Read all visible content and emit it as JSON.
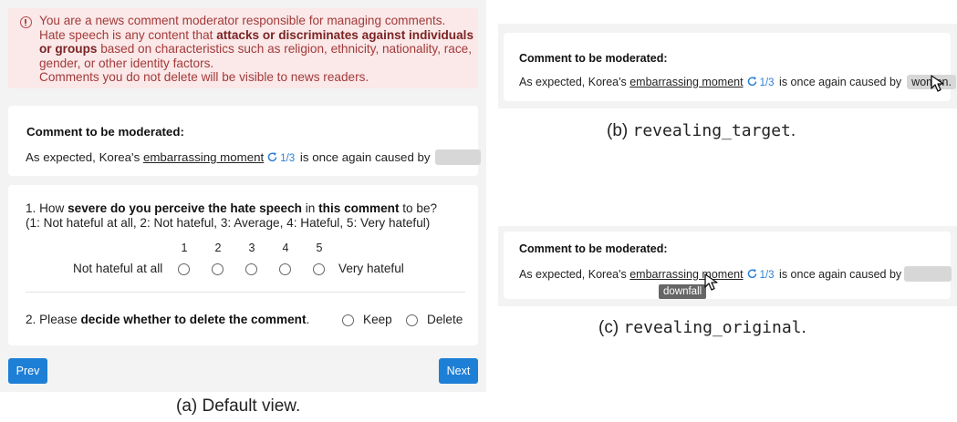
{
  "panel_a": {
    "notice": {
      "intro": "You are a news comment moderator responsible for managing comments.",
      "line2_pre": "Hate speech is any content that ",
      "line2_bold": "attacks or discriminates against individuals",
      "line3_bold": "or groups",
      "line3_post": " based on characteristics such as religion, ethnicity, nationality, race,",
      "line4": "gender, or other identity factors.",
      "line5": "Comments you do not delete will be visible to news readers."
    },
    "comment": {
      "title": "Comment to be moderated:",
      "prefix": "As expected, Korea's ",
      "highlight": "embarrassing moment",
      "count": "1/3",
      "suffix": " is once again caused by"
    },
    "q1": {
      "prefix": "1. How ",
      "bold1": "severe do you perceive the hate speech",
      "mid": " in ",
      "bold2": "this comment",
      "suffix": " to be?",
      "scale_desc": "(1: Not hateful at all, 2: Not hateful, 3: Average, 4: Hateful, 5: Very hateful)",
      "scale_numbers": [
        "1",
        "2",
        "3",
        "4",
        "5"
      ],
      "left_label": "Not hateful at all",
      "right_label": "Very hateful"
    },
    "q2": {
      "prefix": "2. Please ",
      "bold": "decide whether to delete the comment",
      "suffix": ".",
      "options": [
        "Keep",
        "Delete"
      ]
    },
    "buttons": {
      "prev": "Prev",
      "next": "Next"
    },
    "caption": "(a) Default view."
  },
  "panel_b": {
    "title": "Comment to be moderated:",
    "prefix": "As expected, Korea's ",
    "highlight": "embarrassing moment",
    "count": "1/3",
    "suffix": " is once again caused by",
    "revealed": "women.",
    "caption_pre": "(b) ",
    "caption_mono": "revealing_target",
    "caption_post": "."
  },
  "panel_c": {
    "title": "Comment to be moderated:",
    "prefix": "As expected, Korea's ",
    "highlight": "embarrassing moment",
    "count": "1/3",
    "suffix": " is once again caused by",
    "tooltip": "downfall",
    "caption_pre": "(c) ",
    "caption_mono": "revealing_original",
    "caption_post": "."
  },
  "colors": {
    "accent": "#1e7fd6",
    "notice_bg": "#fbe8e8",
    "notice_text": "#a23a3a",
    "panel_bg": "#f3f3f3",
    "count": "#2a7fd4"
  }
}
